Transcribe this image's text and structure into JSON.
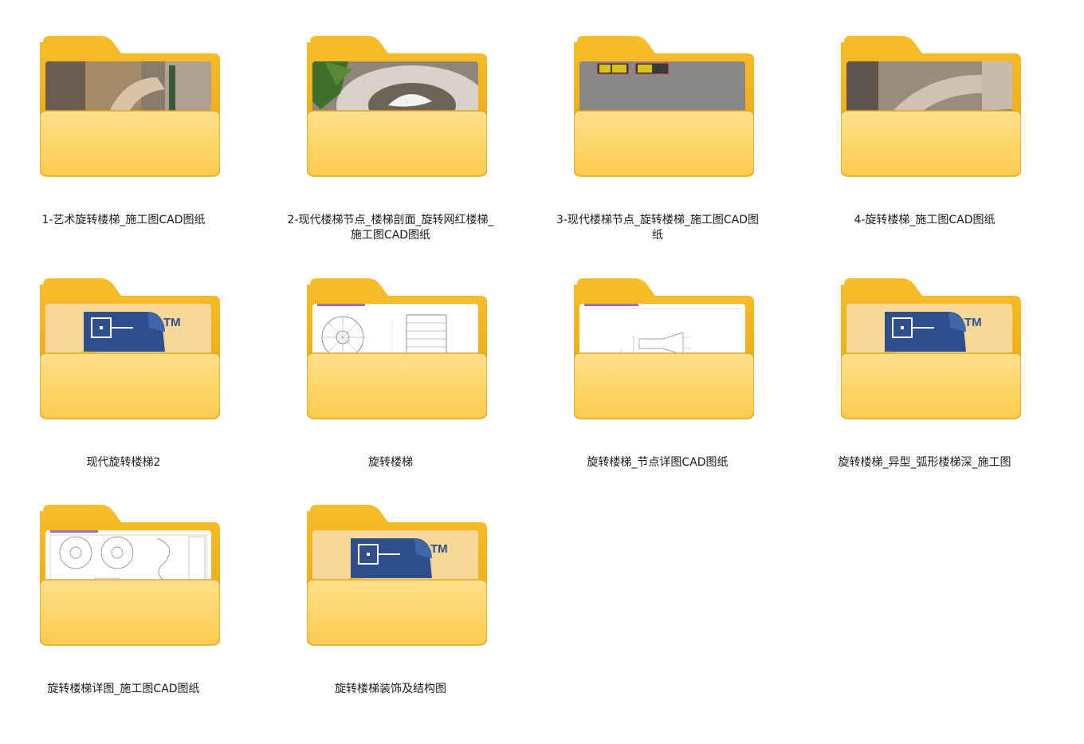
{
  "folders": [
    {
      "name": "1-艺术旋转楼梯_施工图CAD图纸",
      "thumb": "photo-stair-wood"
    },
    {
      "name": "2-现代楼梯节点_楼梯剖面_旋转网红楼梯_施工图CAD图纸",
      "thumb": "photo-stair-plant"
    },
    {
      "name": "3-现代楼梯节点_旋转楼梯_施工图CAD图纸",
      "thumb": "gray-cad-sheet"
    },
    {
      "name": "4-旋转楼梯_施工图CAD图纸",
      "thumb": "photo-stair-curve"
    },
    {
      "name": "现代旋转楼梯2",
      "thumb": "app-logo-tm"
    },
    {
      "name": "旋转楼梯",
      "thumb": "cad-drawing-plan"
    },
    {
      "name": "旋转楼梯_节点详图CAD图纸",
      "thumb": "cad-drawing-detail"
    },
    {
      "name": "旋转楼梯_异型_弧形楼梯深_施工图",
      "thumb": "app-logo-tm"
    },
    {
      "name": "旋转楼梯详图_施工图CAD图纸",
      "thumb": "cad-drawing-spiral"
    },
    {
      "name": "旋转楼梯装饰及结构图",
      "thumb": "app-logo-tm"
    }
  ],
  "logo_text": "TM",
  "colors": {
    "folder_back": "#F2B31F",
    "folder_front": "#FFD76A",
    "logo_navy": "#2E4F8C"
  }
}
